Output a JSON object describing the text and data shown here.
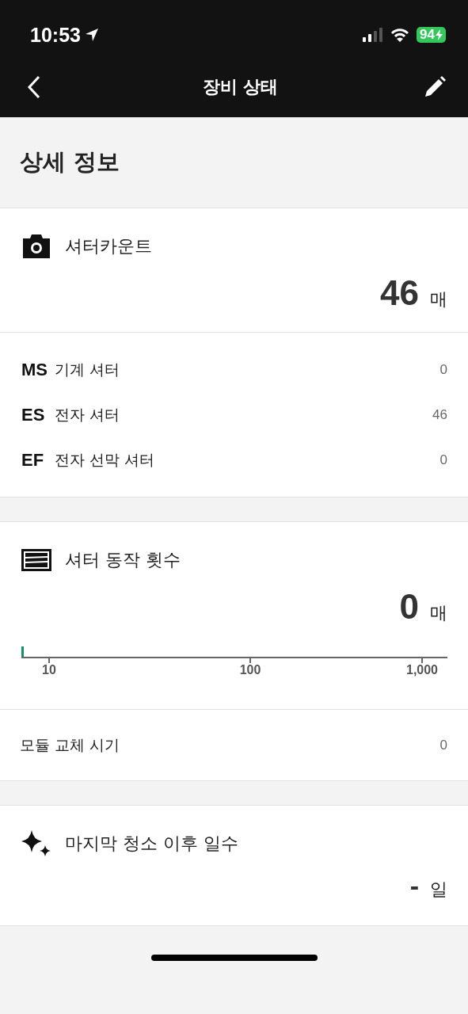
{
  "status_bar": {
    "time": "10:53",
    "battery": "94"
  },
  "nav_bar": {
    "title": "장비 상태"
  },
  "section_title": "상세 정보",
  "shutter_count": {
    "label": "셔터카운트",
    "value": "46",
    "unit": "매",
    "breakdown": [
      {
        "code": "MS",
        "label": "기계 셔터",
        "value": "0"
      },
      {
        "code": "ES",
        "label": "전자 셔터",
        "value": "46"
      },
      {
        "code": "EF",
        "label": "전자 선막 셔터",
        "value": "0"
      }
    ]
  },
  "shutter_operations": {
    "label": "셔터 동작 횟수",
    "value": "0",
    "unit": "매",
    "gauge": {
      "level": 0,
      "ticks": [
        "10",
        "100",
        "1,000"
      ]
    }
  },
  "module_replacement": {
    "label": "모듈 교체 시기",
    "value": "0"
  },
  "days_since_cleaning": {
    "label": "마지막 청소 이후 일수",
    "value": "-",
    "unit": "일"
  }
}
